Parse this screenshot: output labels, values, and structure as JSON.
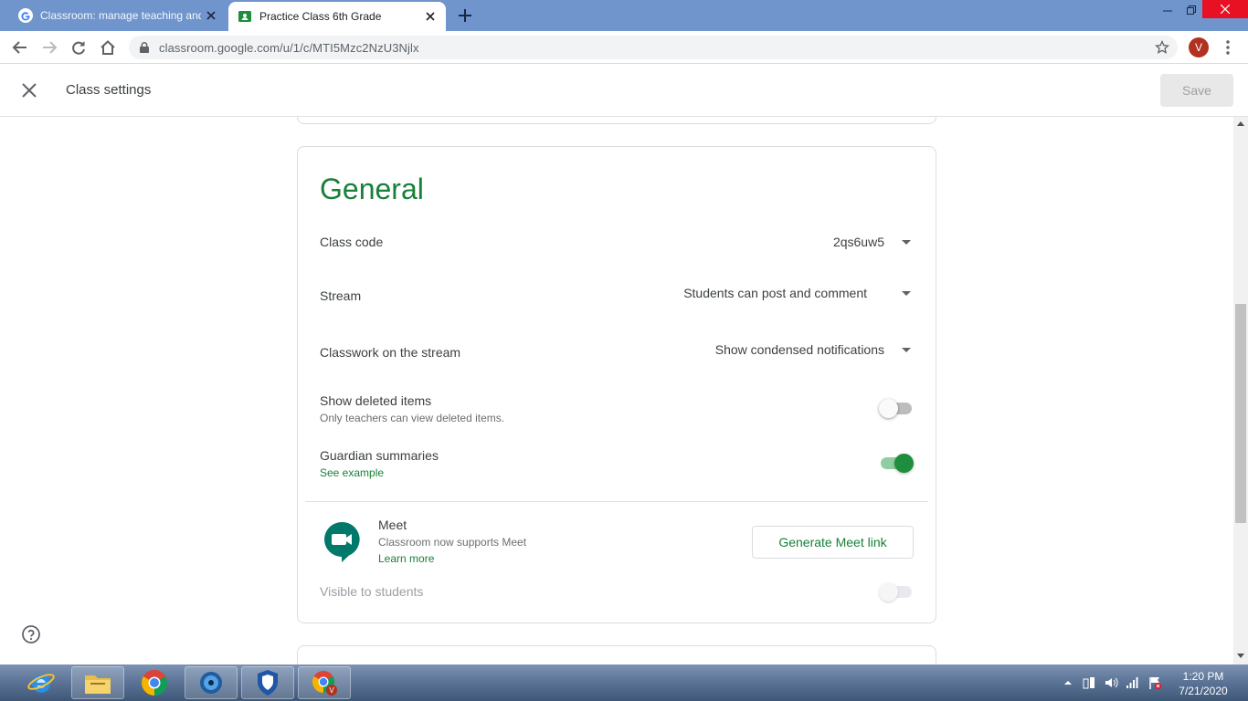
{
  "browser": {
    "tabs": [
      {
        "title": "Classroom: manage teaching and",
        "active": false
      },
      {
        "title": "Practice Class 6th Grade",
        "active": true
      }
    ],
    "url": "classroom.google.com/u/1/c/MTI5Mzc2NzU3Njlx",
    "profile_initial": "V"
  },
  "header": {
    "title": "Class settings",
    "save_label": "Save"
  },
  "general": {
    "title": "General",
    "class_code": {
      "label": "Class code",
      "value": "2qs6uw5"
    },
    "stream": {
      "label": "Stream",
      "value": "Students can post and comment"
    },
    "classwork_stream": {
      "label": "Classwork on the stream",
      "value": "Show condensed notifications"
    },
    "show_deleted": {
      "label": "Show deleted items",
      "sub": "Only teachers can view deleted items.",
      "on": false
    },
    "guardian": {
      "label": "Guardian summaries",
      "link": "See example",
      "on": true
    },
    "meet": {
      "label": "Meet",
      "sub": "Classroom now supports Meet",
      "link": "Learn more",
      "button": "Generate Meet link",
      "visible_label": "Visible to students",
      "visible_on": false
    }
  },
  "taskbar": {
    "time": "1:20 PM",
    "date": "7/21/2020"
  },
  "colors": {
    "accent_green": "#188038",
    "chrome_frame": "#6f95cc",
    "avatar": "#b23121"
  }
}
